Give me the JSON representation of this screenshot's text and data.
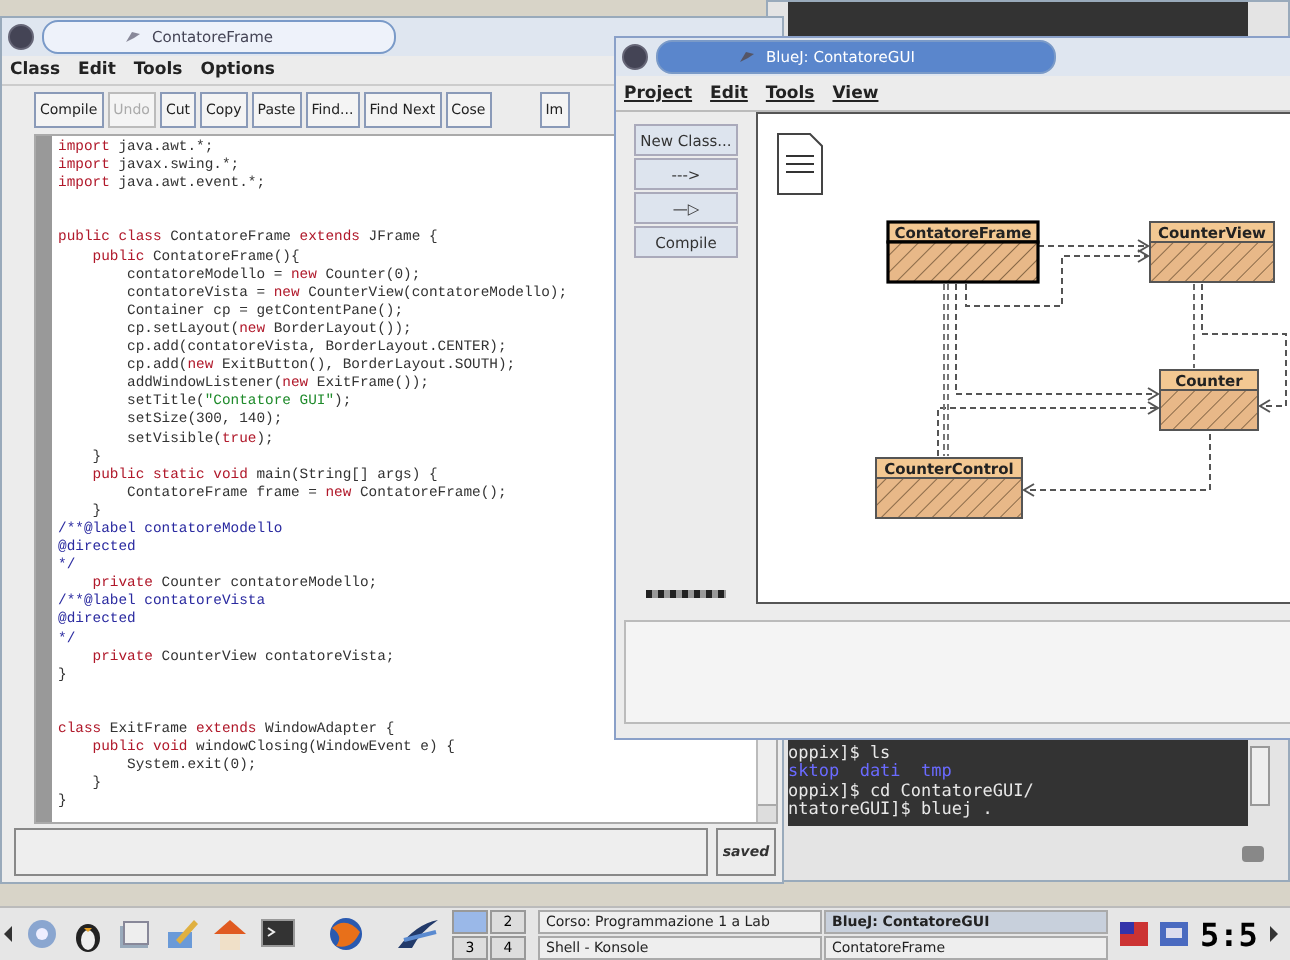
{
  "editor": {
    "title": "ContatoreFrame",
    "menu": [
      "Class",
      "Edit",
      "Tools",
      "Options"
    ],
    "toolbar": [
      {
        "label": "Compile",
        "disabled": false
      },
      {
        "label": "Undo",
        "disabled": true
      },
      {
        "label": "Cut",
        "disabled": false
      },
      {
        "label": "Copy",
        "disabled": false
      },
      {
        "label": "Paste",
        "disabled": false
      },
      {
        "label": "Find...",
        "disabled": false
      },
      {
        "label": "Find Next",
        "disabled": false
      },
      {
        "label": "Cose",
        "disabled": false
      },
      {
        "label": "Im",
        "disabled": false
      }
    ],
    "code": [
      {
        "kind": "code",
        "segments": [
          {
            "kind": "keyword",
            "text": "import"
          },
          {
            "kind": "plain",
            "text": " java.awt.*;"
          }
        ]
      },
      {
        "kind": "code",
        "segments": [
          {
            "kind": "keyword",
            "text": "import"
          },
          {
            "kind": "plain",
            "text": " javax.swing.*;"
          }
        ]
      },
      {
        "kind": "code",
        "segments": [
          {
            "kind": "keyword",
            "text": "import"
          },
          {
            "kind": "plain",
            "text": " java.awt.event.*;"
          }
        ]
      },
      {
        "kind": "blank"
      },
      {
        "kind": "blank"
      },
      {
        "kind": "code",
        "segments": [
          {
            "kind": "keyword",
            "text": "public class"
          },
          {
            "kind": "plain",
            "text": " ContatoreFrame "
          },
          {
            "kind": "keyword",
            "text": "extends"
          },
          {
            "kind": "plain",
            "text": " JFrame {"
          }
        ]
      },
      {
        "kind": "code",
        "segments": [
          {
            "kind": "keyword",
            "text": "    public"
          },
          {
            "kind": "plain",
            "text": " ContatoreFrame(){"
          }
        ]
      },
      {
        "kind": "code",
        "segments": [
          {
            "kind": "plain",
            "text": "        contatoreModello = "
          },
          {
            "kind": "keyword",
            "text": "new"
          },
          {
            "kind": "plain",
            "text": " Counter(0);"
          }
        ]
      },
      {
        "kind": "code",
        "segments": [
          {
            "kind": "plain",
            "text": "        contatoreVista = "
          },
          {
            "kind": "keyword",
            "text": "new"
          },
          {
            "kind": "plain",
            "text": " CounterView(contatoreModello);"
          }
        ]
      },
      {
        "kind": "code",
        "segments": [
          {
            "kind": "plain",
            "text": "        Container cp = getContentPane();"
          }
        ]
      },
      {
        "kind": "code",
        "segments": [
          {
            "kind": "plain",
            "text": "        cp.setLayout("
          },
          {
            "kind": "keyword",
            "text": "new"
          },
          {
            "kind": "plain",
            "text": " BorderLayout());"
          }
        ]
      },
      {
        "kind": "code",
        "segments": [
          {
            "kind": "plain",
            "text": "        cp.add(contatoreVista, BorderLayout.CENTER);"
          }
        ]
      },
      {
        "kind": "code",
        "segments": [
          {
            "kind": "plain",
            "text": "        cp.add("
          },
          {
            "kind": "keyword",
            "text": "new"
          },
          {
            "kind": "plain",
            "text": " ExitButton(), BorderLayout.SOUTH);"
          }
        ]
      },
      {
        "kind": "code",
        "segments": [
          {
            "kind": "plain",
            "text": "        addWindowListener("
          },
          {
            "kind": "keyword",
            "text": "new"
          },
          {
            "kind": "plain",
            "text": " ExitFrame());"
          }
        ]
      },
      {
        "kind": "code",
        "segments": [
          {
            "kind": "plain",
            "text": "        setTitle("
          },
          {
            "kind": "string",
            "text": "\"Contatore GUI\""
          },
          {
            "kind": "plain",
            "text": ");"
          }
        ]
      },
      {
        "kind": "code",
        "segments": [
          {
            "kind": "plain",
            "text": "        setSize(300, 140);"
          }
        ]
      },
      {
        "kind": "code",
        "segments": [
          {
            "kind": "plain",
            "text": "        setVisible("
          },
          {
            "kind": "keyword",
            "text": "true"
          },
          {
            "kind": "plain",
            "text": ");"
          }
        ]
      },
      {
        "kind": "code",
        "segments": [
          {
            "kind": "plain",
            "text": "    }"
          }
        ]
      },
      {
        "kind": "code",
        "segments": [
          {
            "kind": "keyword",
            "text": "    public static void"
          },
          {
            "kind": "plain",
            "text": " main(String[] args) {"
          }
        ]
      },
      {
        "kind": "code",
        "segments": [
          {
            "kind": "plain",
            "text": "        ContatoreFrame frame = "
          },
          {
            "kind": "keyword",
            "text": "new"
          },
          {
            "kind": "plain",
            "text": " ContatoreFrame();"
          }
        ]
      },
      {
        "kind": "code",
        "segments": [
          {
            "kind": "plain",
            "text": "    }"
          }
        ]
      },
      {
        "kind": "code",
        "segments": [
          {
            "kind": "comment",
            "text": "/**@label contatoreModello"
          }
        ]
      },
      {
        "kind": "code",
        "segments": [
          {
            "kind": "comment",
            "text": "@directed"
          }
        ]
      },
      {
        "kind": "code",
        "segments": [
          {
            "kind": "comment",
            "text": "*/"
          }
        ]
      },
      {
        "kind": "code",
        "segments": [
          {
            "kind": "keyword",
            "text": "    private"
          },
          {
            "kind": "plain",
            "text": " Counter contatoreModello;"
          }
        ]
      },
      {
        "kind": "code",
        "segments": [
          {
            "kind": "comment",
            "text": "/**@label contatoreVista"
          }
        ]
      },
      {
        "kind": "code",
        "segments": [
          {
            "kind": "comment",
            "text": "@directed"
          }
        ]
      },
      {
        "kind": "code",
        "segments": [
          {
            "kind": "comment",
            "text": "*/"
          }
        ]
      },
      {
        "kind": "code",
        "segments": [
          {
            "kind": "keyword",
            "text": "    private"
          },
          {
            "kind": "plain",
            "text": " CounterView contatoreVista;"
          }
        ]
      },
      {
        "kind": "code",
        "segments": [
          {
            "kind": "plain",
            "text": "}"
          }
        ]
      },
      {
        "kind": "blank"
      },
      {
        "kind": "blank"
      },
      {
        "kind": "code",
        "segments": [
          {
            "kind": "keyword",
            "text": "class"
          },
          {
            "kind": "plain",
            "text": " ExitFrame "
          },
          {
            "kind": "keyword",
            "text": "extends"
          },
          {
            "kind": "plain",
            "text": " WindowAdapter {"
          }
        ]
      },
      {
        "kind": "code",
        "segments": [
          {
            "kind": "keyword",
            "text": "    public void"
          },
          {
            "kind": "plain",
            "text": " windowClosing(WindowEvent e) {"
          }
        ]
      },
      {
        "kind": "code",
        "segments": [
          {
            "kind": "plain",
            "text": "        System.exit(0);"
          }
        ]
      },
      {
        "kind": "code",
        "segments": [
          {
            "kind": "plain",
            "text": "    }"
          }
        ]
      },
      {
        "kind": "code",
        "segments": [
          {
            "kind": "plain",
            "text": "}"
          }
        ]
      }
    ],
    "status": "saved"
  },
  "terminal": {
    "lines": [
      {
        "kind": "prompt",
        "text": "oppix]$ ls"
      },
      {
        "kind": "listing",
        "text": "sktop  dati  tmp"
      },
      {
        "kind": "prompt",
        "text": "oppix]$ cd ContatoreGUI/"
      },
      {
        "kind": "prompt",
        "text": "ntatoreGUI]$ bluej ."
      }
    ]
  },
  "bluej": {
    "title": "BlueJ: ContatoreGUI",
    "menu": [
      "Project",
      "Edit",
      "Tools",
      "View"
    ],
    "buttons": [
      "New Class...",
      "--->",
      "—▷",
      "Compile"
    ],
    "classes": [
      {
        "name": "ContatoreFrame",
        "selected": true
      },
      {
        "name": "CounterView",
        "selected": false
      },
      {
        "name": "Counter",
        "selected": false
      },
      {
        "name": "CounterControl",
        "selected": false
      }
    ]
  },
  "taskbar": {
    "pager": [
      {
        "selected": true
      },
      {
        "label": "2",
        "selected": false
      },
      {
        "label": "3",
        "selected": false
      },
      {
        "label": "4",
        "selected": false
      }
    ],
    "tasks": [
      {
        "title": "Corso: Programmazione 1 a Lab",
        "selected": false
      },
      {
        "title": "BlueJ: ContatoreGUI",
        "selected": true
      },
      {
        "title": "Shell - Konsole",
        "selected": false
      },
      {
        "title": "ContatoreFrame",
        "selected": false
      }
    ],
    "clock": "5:5"
  }
}
